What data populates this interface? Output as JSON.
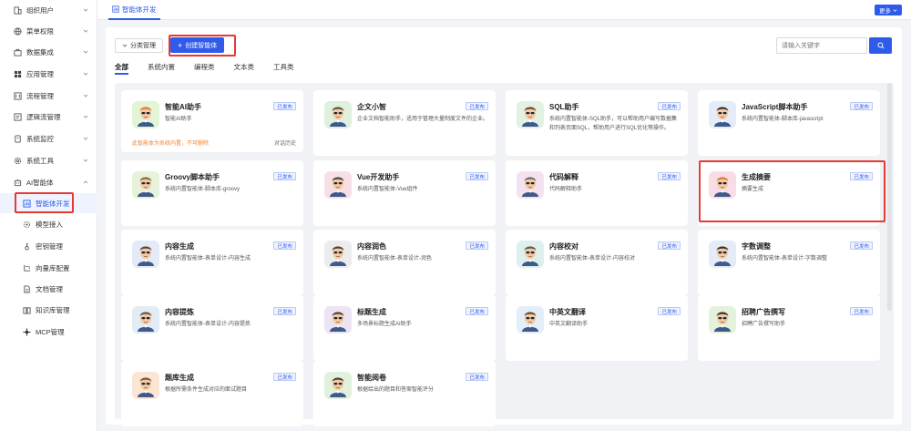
{
  "sidebar": {
    "items": [
      {
        "label": "组织用户",
        "icon": "building-icon",
        "expanded": false
      },
      {
        "label": "菜单权限",
        "icon": "globe-icon",
        "expanded": false
      },
      {
        "label": "数据集成",
        "icon": "briefcase-icon",
        "expanded": false
      },
      {
        "label": "应用管理",
        "icon": "grid-icon",
        "expanded": false
      },
      {
        "label": "流程管理",
        "icon": "flow-icon",
        "expanded": false
      },
      {
        "label": "逻辑流管理",
        "icon": "logic-icon",
        "expanded": false
      },
      {
        "label": "系统监控",
        "icon": "monitor-icon",
        "expanded": false
      },
      {
        "label": "系统工具",
        "icon": "gear-icon",
        "expanded": false
      },
      {
        "label": "AI智能体",
        "icon": "ai-icon",
        "expanded": true
      }
    ],
    "sub_items": [
      {
        "label": "智能体开发",
        "icon": "agent-dev-icon",
        "active": true
      },
      {
        "label": "模型接入",
        "icon": "model-icon"
      },
      {
        "label": "密钥管理",
        "icon": "key-icon"
      },
      {
        "label": "向量库配置",
        "icon": "vector-icon"
      },
      {
        "label": "文档管理",
        "icon": "document-icon"
      },
      {
        "label": "知识库管理",
        "icon": "book-icon"
      },
      {
        "label": "MCP管理",
        "icon": "mcp-icon"
      }
    ]
  },
  "topbar": {
    "tab_label": "智能体开发",
    "more_label": "更多"
  },
  "toolbar": {
    "category_label": "分类管理",
    "create_label": "创建智能体",
    "search_placeholder": "请输入关键字"
  },
  "filter_tabs": [
    "全部",
    "系统内置",
    "编程类",
    "文本类",
    "工具类"
  ],
  "cards": [
    {
      "title": "智能AI助手",
      "desc": "智能AI助手",
      "badge": "已发布",
      "note": "此智能体为系统内置，不可删除",
      "link": "对话历史",
      "color": "#e4f4d6"
    },
    {
      "title": "企文小智",
      "desc": "企业文档智能助手，适用于管理大量制度文件的企业。",
      "badge": "已发布",
      "color": "#dff0dc"
    },
    {
      "title": "SQL助手",
      "desc": "系统内置智能体-SQL助手，可以帮助用户编写数据集和列表页面SQL，帮助用户进行SQL优化等操作。",
      "badge": "已发布",
      "color": "#e3f1e3"
    },
    {
      "title": "JavaScript脚本助手",
      "desc": "系统内置智能体-脚本库-javascript",
      "badge": "已发布",
      "color": "#e3ecf7"
    },
    {
      "title": "Groovy脚本助手",
      "desc": "系统内置智能体-脚本库-groovy",
      "badge": "已发布",
      "color": "#e6f2d9"
    },
    {
      "title": "Vue开发助手",
      "desc": "系统内置智能体-Vue组件",
      "badge": "已发布",
      "color": "#f8dfe6"
    },
    {
      "title": "代码解释",
      "desc": "代码解释助手",
      "badge": "已发布",
      "color": "#f5e2f1"
    },
    {
      "title": "生成摘要",
      "desc": "摘要生成",
      "badge": "已发布",
      "color": "#f9dde6"
    },
    {
      "title": "内容生成",
      "desc": "系统内置智能体-表单设计-内容生成",
      "badge": "已发布",
      "color": "#e3ebf8"
    },
    {
      "title": "内容润色",
      "desc": "系统内置智能体-表单设计-润色",
      "badge": "已发布",
      "color": "#ececec"
    },
    {
      "title": "内容校对",
      "desc": "系统内置智能体-表单设计-内容校对",
      "badge": "已发布",
      "color": "#def0ee"
    },
    {
      "title": "字数调整",
      "desc": "系统内置智能体-表单设计-字数调整",
      "badge": "已发布",
      "color": "#e3ecf7"
    },
    {
      "title": "内容提炼",
      "desc": "系统内置智能体-表单设计-内容提炼",
      "badge": "已发布",
      "color": "#e2ecf5"
    },
    {
      "title": "标题生成",
      "desc": "多场景标题生成AI助手",
      "badge": "已发布",
      "color": "#ece3f3"
    },
    {
      "title": "中英文翻译",
      "desc": "中英文翻译助手",
      "badge": "已发布",
      "color": "#e3eef9"
    },
    {
      "title": "招聘广告撰写",
      "desc": "招聘广告撰写助手",
      "badge": "已发布",
      "color": "#e4f2dc"
    },
    {
      "title": "题库生成",
      "desc": "根据所需条件生成对应的面试题目",
      "badge": "已发布",
      "color": "#fbe6d6"
    },
    {
      "title": "智能阅卷",
      "desc": "根据给出的题目和答案智能评分",
      "badge": "已发布",
      "color": "#e2f1dc"
    }
  ],
  "colors": {
    "primary": "#2f5bea",
    "highlight": "#e53935",
    "note": "#f0842c"
  }
}
